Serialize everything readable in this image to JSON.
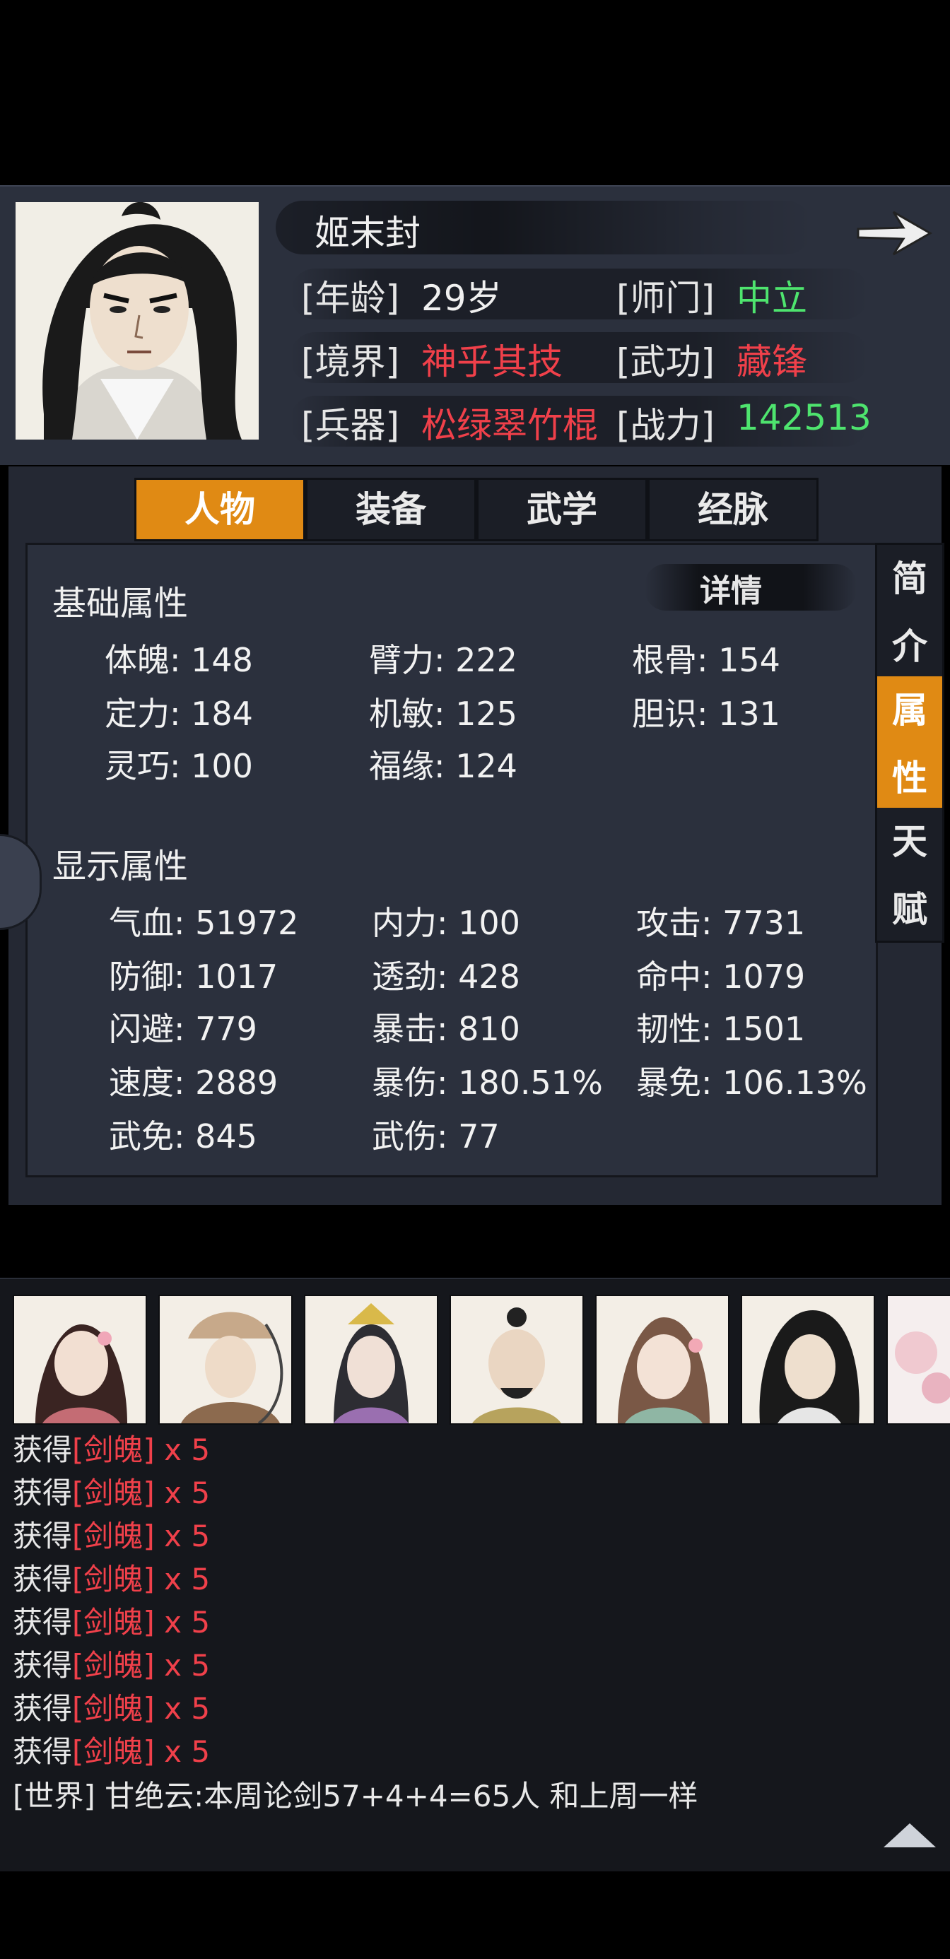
{
  "character": {
    "name": "姬末封",
    "fields": [
      {
        "label": "[年龄]",
        "value": "29岁",
        "color": "#f0f0f0"
      },
      {
        "label": "[师门]",
        "value": "中立",
        "color": "#4ee46e"
      },
      {
        "label": "[境界]",
        "value": "神乎其技",
        "color": "#f0404a"
      },
      {
        "label": "[武功]",
        "value": "藏锋",
        "color": "#f0404a"
      },
      {
        "label": "[兵器]",
        "value": "松绿翠竹棍",
        "color": "#f0404a"
      },
      {
        "label": "[战力]",
        "value": "142513",
        "color": "#4ee46e"
      }
    ]
  },
  "tabs": [
    "人物",
    "装备",
    "武学",
    "经脉"
  ],
  "active_tab": "人物",
  "side_tabs": [
    "简介",
    "属性",
    "天赋"
  ],
  "active_side_tab": "属性",
  "detail_button": "详情",
  "base_section": {
    "title": "基础属性",
    "stats": [
      "体魄: 148",
      "臂力: 222",
      "根骨: 154",
      "定力: 184",
      "机敏: 125",
      "胆识: 131",
      "灵巧: 100",
      "福缘: 124"
    ]
  },
  "display_section": {
    "title": "显示属性",
    "stats": [
      "气血: 51972",
      "内力: 100",
      "攻击: 7731",
      "防御: 1017",
      "透劲: 428",
      "命中: 1079",
      "闪避: 779",
      "暴击: 810",
      "韧性: 1501",
      "速度: 2889",
      "暴伤: 180.51%",
      "暴免: 106.13%",
      "武免: 845",
      "武伤: 77"
    ]
  },
  "log": {
    "gain_prefix": "获得",
    "gain_item": "[剑魄]",
    "gain_count": " x 5",
    "gain_lines": 8,
    "world_message": "[世界] 甘绝云:本周论剑57+4+4=65人 和上周一样"
  },
  "icons": {
    "next": "arrow-right-icon",
    "scroll_up": "triangle-up-icon"
  },
  "colors": {
    "accent": "#e08a14",
    "green": "#4ee46e",
    "red": "#f0404a"
  }
}
